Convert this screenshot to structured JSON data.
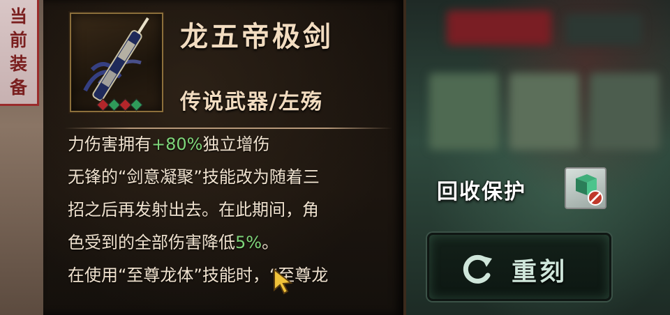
{
  "side_tab": {
    "label_chars": [
      "当",
      "前",
      "装",
      "备"
    ]
  },
  "item": {
    "name": "龙五帝极剑",
    "type": "传说武器/左殇",
    "icon": "sword-icon",
    "gems": [
      "red",
      "green",
      "red",
      "green"
    ]
  },
  "description": {
    "lines": [
      {
        "parts": [
          {
            "text": "力伤害拥有"
          },
          {
            "text": "+80%",
            "highlight": true
          },
          {
            "text": "独立增伤"
          }
        ]
      },
      {
        "parts": [
          {
            "text": "无锋的“剑意凝聚”技能改为随着三"
          }
        ]
      },
      {
        "parts": [
          {
            "text": "招之后再发射出去。在此期间，角"
          }
        ]
      },
      {
        "parts": [
          {
            "text": "色受到的全部伤害降低"
          },
          {
            "text": "5%",
            "highlight": true
          },
          {
            "text": "。"
          }
        ]
      },
      {
        "parts": [
          {
            "text": "在使用“至尊龙体”技能时，“至尊龙"
          }
        ]
      }
    ]
  },
  "recycle_protection": {
    "label": "回收保护",
    "icon": "recycle-protection-icon"
  },
  "reforge_button": {
    "label": "重刻",
    "icon": "refresh-icon"
  },
  "colors": {
    "highlight": "#7fd67a",
    "title_text": "#f2dcc0",
    "tag_text": "#7a1f1f",
    "button_border": "#3b5247"
  }
}
